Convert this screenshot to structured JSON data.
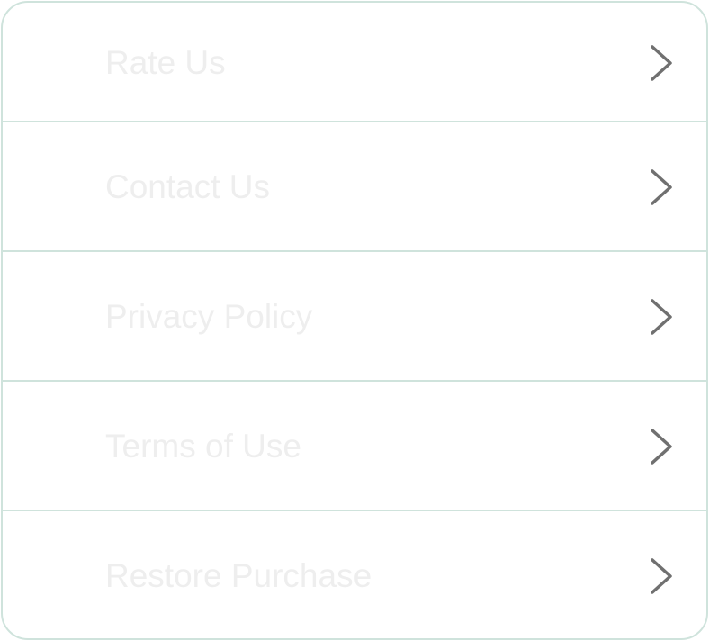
{
  "menu": {
    "items": [
      {
        "label": "Rate Us",
        "icon": "chevron-right-icon"
      },
      {
        "label": "Contact Us",
        "icon": "chevron-right-icon"
      },
      {
        "label": "Privacy Policy",
        "icon": "chevron-right-icon"
      },
      {
        "label": "Terms of Use",
        "icon": "chevron-right-icon"
      },
      {
        "label": "Restore Purchase",
        "icon": "chevron-right-icon"
      }
    ]
  },
  "colors": {
    "border": "#cfe3dc",
    "label_text": "#eeeeee",
    "chevron": "#707070"
  }
}
